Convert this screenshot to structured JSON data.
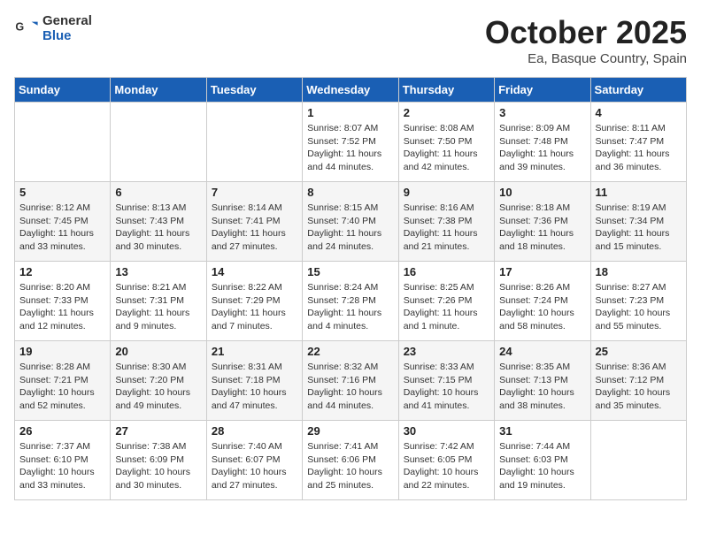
{
  "header": {
    "logo_general": "General",
    "logo_blue": "Blue",
    "title": "October 2025",
    "subtitle": "Ea, Basque Country, Spain"
  },
  "days_of_week": [
    "Sunday",
    "Monday",
    "Tuesday",
    "Wednesday",
    "Thursday",
    "Friday",
    "Saturday"
  ],
  "weeks": [
    [
      {
        "day": "",
        "info": ""
      },
      {
        "day": "",
        "info": ""
      },
      {
        "day": "",
        "info": ""
      },
      {
        "day": "1",
        "info": "Sunrise: 8:07 AM\nSunset: 7:52 PM\nDaylight: 11 hours and 44 minutes."
      },
      {
        "day": "2",
        "info": "Sunrise: 8:08 AM\nSunset: 7:50 PM\nDaylight: 11 hours and 42 minutes."
      },
      {
        "day": "3",
        "info": "Sunrise: 8:09 AM\nSunset: 7:48 PM\nDaylight: 11 hours and 39 minutes."
      },
      {
        "day": "4",
        "info": "Sunrise: 8:11 AM\nSunset: 7:47 PM\nDaylight: 11 hours and 36 minutes."
      }
    ],
    [
      {
        "day": "5",
        "info": "Sunrise: 8:12 AM\nSunset: 7:45 PM\nDaylight: 11 hours and 33 minutes."
      },
      {
        "day": "6",
        "info": "Sunrise: 8:13 AM\nSunset: 7:43 PM\nDaylight: 11 hours and 30 minutes."
      },
      {
        "day": "7",
        "info": "Sunrise: 8:14 AM\nSunset: 7:41 PM\nDaylight: 11 hours and 27 minutes."
      },
      {
        "day": "8",
        "info": "Sunrise: 8:15 AM\nSunset: 7:40 PM\nDaylight: 11 hours and 24 minutes."
      },
      {
        "day": "9",
        "info": "Sunrise: 8:16 AM\nSunset: 7:38 PM\nDaylight: 11 hours and 21 minutes."
      },
      {
        "day": "10",
        "info": "Sunrise: 8:18 AM\nSunset: 7:36 PM\nDaylight: 11 hours and 18 minutes."
      },
      {
        "day": "11",
        "info": "Sunrise: 8:19 AM\nSunset: 7:34 PM\nDaylight: 11 hours and 15 minutes."
      }
    ],
    [
      {
        "day": "12",
        "info": "Sunrise: 8:20 AM\nSunset: 7:33 PM\nDaylight: 11 hours and 12 minutes."
      },
      {
        "day": "13",
        "info": "Sunrise: 8:21 AM\nSunset: 7:31 PM\nDaylight: 11 hours and 9 minutes."
      },
      {
        "day": "14",
        "info": "Sunrise: 8:22 AM\nSunset: 7:29 PM\nDaylight: 11 hours and 7 minutes."
      },
      {
        "day": "15",
        "info": "Sunrise: 8:24 AM\nSunset: 7:28 PM\nDaylight: 11 hours and 4 minutes."
      },
      {
        "day": "16",
        "info": "Sunrise: 8:25 AM\nSunset: 7:26 PM\nDaylight: 11 hours and 1 minute."
      },
      {
        "day": "17",
        "info": "Sunrise: 8:26 AM\nSunset: 7:24 PM\nDaylight: 10 hours and 58 minutes."
      },
      {
        "day": "18",
        "info": "Sunrise: 8:27 AM\nSunset: 7:23 PM\nDaylight: 10 hours and 55 minutes."
      }
    ],
    [
      {
        "day": "19",
        "info": "Sunrise: 8:28 AM\nSunset: 7:21 PM\nDaylight: 10 hours and 52 minutes."
      },
      {
        "day": "20",
        "info": "Sunrise: 8:30 AM\nSunset: 7:20 PM\nDaylight: 10 hours and 49 minutes."
      },
      {
        "day": "21",
        "info": "Sunrise: 8:31 AM\nSunset: 7:18 PM\nDaylight: 10 hours and 47 minutes."
      },
      {
        "day": "22",
        "info": "Sunrise: 8:32 AM\nSunset: 7:16 PM\nDaylight: 10 hours and 44 minutes."
      },
      {
        "day": "23",
        "info": "Sunrise: 8:33 AM\nSunset: 7:15 PM\nDaylight: 10 hours and 41 minutes."
      },
      {
        "day": "24",
        "info": "Sunrise: 8:35 AM\nSunset: 7:13 PM\nDaylight: 10 hours and 38 minutes."
      },
      {
        "day": "25",
        "info": "Sunrise: 8:36 AM\nSunset: 7:12 PM\nDaylight: 10 hours and 35 minutes."
      }
    ],
    [
      {
        "day": "26",
        "info": "Sunrise: 7:37 AM\nSunset: 6:10 PM\nDaylight: 10 hours and 33 minutes."
      },
      {
        "day": "27",
        "info": "Sunrise: 7:38 AM\nSunset: 6:09 PM\nDaylight: 10 hours and 30 minutes."
      },
      {
        "day": "28",
        "info": "Sunrise: 7:40 AM\nSunset: 6:07 PM\nDaylight: 10 hours and 27 minutes."
      },
      {
        "day": "29",
        "info": "Sunrise: 7:41 AM\nSunset: 6:06 PM\nDaylight: 10 hours and 25 minutes."
      },
      {
        "day": "30",
        "info": "Sunrise: 7:42 AM\nSunset: 6:05 PM\nDaylight: 10 hours and 22 minutes."
      },
      {
        "day": "31",
        "info": "Sunrise: 7:44 AM\nSunset: 6:03 PM\nDaylight: 10 hours and 19 minutes."
      },
      {
        "day": "",
        "info": ""
      }
    ]
  ]
}
